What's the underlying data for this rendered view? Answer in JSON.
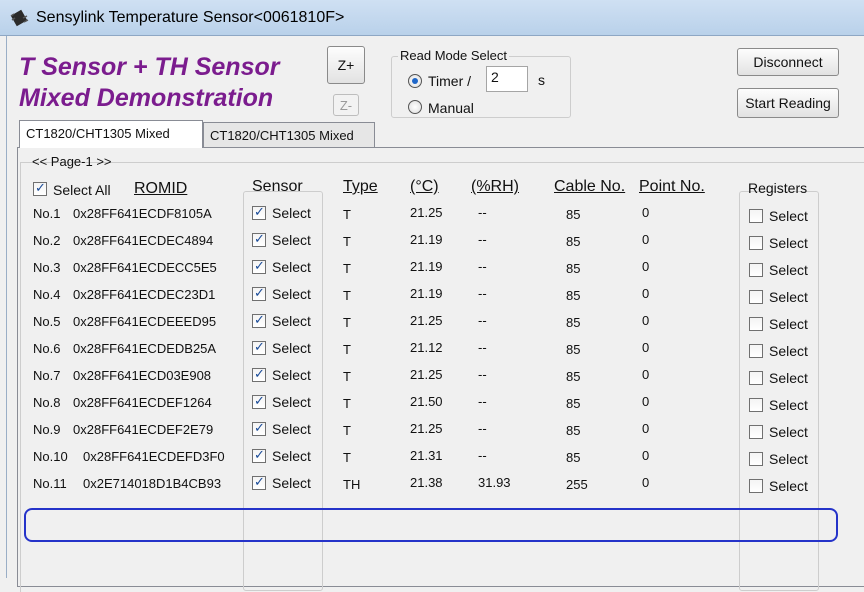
{
  "window": {
    "title": "Sensylink Temperature Sensor<0061810F>"
  },
  "heading": {
    "line1": "T Sensor + TH Sensor",
    "line2": "Mixed Demonstration"
  },
  "zoom": {
    "in_label": "Z+",
    "out_label": "Z-"
  },
  "read_mode": {
    "legend": "Read Mode Select",
    "timer_label": "Timer /",
    "timer_value": "2",
    "timer_unit": "s",
    "manual_label": "Manual",
    "selected": "timer"
  },
  "buttons": {
    "disconnect": "Disconnect",
    "start_reading": "Start Reading"
  },
  "tabs": [
    {
      "label": "CT1820/CHT1305  Mixed",
      "active": true
    },
    {
      "label": "CT1820/CHT1305  Mixed",
      "active": false
    }
  ],
  "page_label": "<< Page-1 >>",
  "headers": {
    "select_all": "Select All",
    "romid": "ROMID",
    "sensor": "Sensor",
    "type": "Type",
    "temp": "(°C)",
    "rh": "(%RH)",
    "cable": "Cable No.",
    "point": "Point No.",
    "registers": "Registers"
  },
  "select_label": "Select",
  "rows": [
    {
      "no": "No.1",
      "romid": "0x28FF641ECDF8105A",
      "sensor": true,
      "type": "T",
      "temp": "21.25",
      "rh": "--",
      "cable": "85",
      "point": "0",
      "register": false
    },
    {
      "no": "No.2",
      "romid": "0x28FF641ECDEC4894",
      "sensor": true,
      "type": "T",
      "temp": "21.19",
      "rh": "--",
      "cable": "85",
      "point": "0",
      "register": false
    },
    {
      "no": "No.3",
      "romid": "0x28FF641ECDECC5E5",
      "sensor": true,
      "type": "T",
      "temp": "21.19",
      "rh": "--",
      "cable": "85",
      "point": "0",
      "register": false
    },
    {
      "no": "No.4",
      "romid": "0x28FF641ECDEC23D1",
      "sensor": true,
      "type": "T",
      "temp": "21.19",
      "rh": "--",
      "cable": "85",
      "point": "0",
      "register": false
    },
    {
      "no": "No.5",
      "romid": "0x28FF641ECDEEED95",
      "sensor": true,
      "type": "T",
      "temp": "21.25",
      "rh": "--",
      "cable": "85",
      "point": "0",
      "register": false
    },
    {
      "no": "No.6",
      "romid": "0x28FF641ECDEDB25A",
      "sensor": true,
      "type": "T",
      "temp": "21.12",
      "rh": "--",
      "cable": "85",
      "point": "0",
      "register": false
    },
    {
      "no": "No.7",
      "romid": "0x28FF641ECD03E908",
      "sensor": true,
      "type": "T",
      "temp": "21.25",
      "rh": "--",
      "cable": "85",
      "point": "0",
      "register": false
    },
    {
      "no": "No.8",
      "romid": "0x28FF641ECDEF1264",
      "sensor": true,
      "type": "T",
      "temp": "21.50",
      "rh": "--",
      "cable": "85",
      "point": "0",
      "register": false
    },
    {
      "no": "No.9",
      "romid": "0x28FF641ECDEF2E79",
      "sensor": true,
      "type": "T",
      "temp": "21.25",
      "rh": "--",
      "cable": "85",
      "point": "0",
      "register": false
    },
    {
      "no": "No.10",
      "romid": "0x28FF641ECDEFD3F0",
      "sensor": true,
      "type": "T",
      "temp": "21.31",
      "rh": "--",
      "cable": "85",
      "point": "0",
      "register": false
    },
    {
      "no": "No.11",
      "romid": "0x2E714018D1B4CB93",
      "sensor": true,
      "type": "TH",
      "temp": "21.38",
      "rh": "31.93",
      "cable": "255",
      "point": "0",
      "register": false
    }
  ]
}
